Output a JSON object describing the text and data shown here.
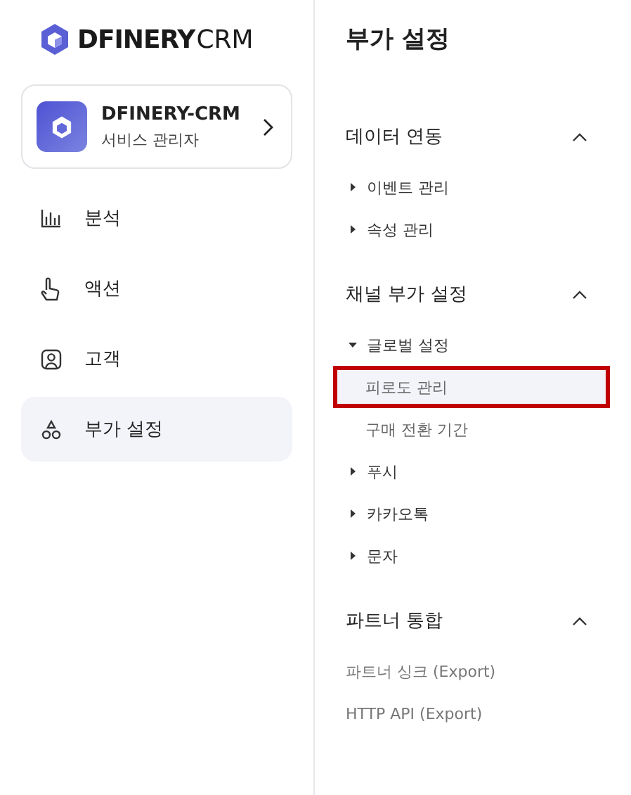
{
  "sidebar": {
    "logo": {
      "brand": "DFINERY",
      "product": "CRM"
    },
    "workspace": {
      "name": "DFINERY-CRM",
      "role": "서비스 관리자"
    },
    "items": [
      {
        "label": "분석",
        "kind": "analytics",
        "selected": false
      },
      {
        "label": "액션",
        "kind": "action",
        "selected": false
      },
      {
        "label": "고객",
        "kind": "customer",
        "selected": false
      },
      {
        "label": "부가 설정",
        "kind": "settings",
        "selected": true
      }
    ]
  },
  "panel": {
    "title": "부가 설정",
    "sections": [
      {
        "title": "데이터 연동",
        "expanded": true,
        "items": [
          {
            "label": "이벤트 관리",
            "kind": "folder",
            "expanded": false
          },
          {
            "label": "속성 관리",
            "kind": "folder",
            "expanded": false
          }
        ]
      },
      {
        "title": "채널 부가 설정",
        "expanded": true,
        "items": [
          {
            "label": "글로벌 설정",
            "kind": "folder",
            "expanded": true,
            "children": [
              {
                "label": "피로도 관리",
                "kind": "link",
                "selected": true,
                "highlighted": true
              },
              {
                "label": "구매 전환 기간",
                "kind": "link",
                "selected": false,
                "highlighted": false
              }
            ]
          },
          {
            "label": "푸시",
            "kind": "folder",
            "expanded": false
          },
          {
            "label": "카카오톡",
            "kind": "folder",
            "expanded": false
          },
          {
            "label": "문자",
            "kind": "folder",
            "expanded": false
          }
        ]
      },
      {
        "title": "파트너 통합",
        "expanded": true,
        "items": [
          {
            "label": "파트너 싱크 (Export)",
            "kind": "page"
          },
          {
            "label": "HTTP API (Export)",
            "kind": "page"
          }
        ]
      }
    ]
  }
}
